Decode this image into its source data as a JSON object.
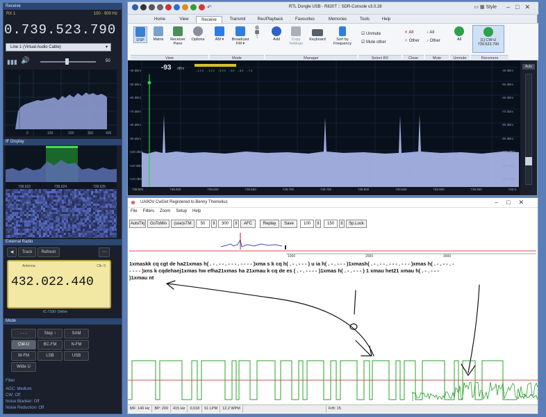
{
  "left": {
    "header": "Receive",
    "rx": "RX 1",
    "rx_range": "100 - 900 Hz",
    "frequency": "0.739.523.790",
    "line_select": "Line 1 (Virtual Audio Cable)",
    "volume": "50",
    "spectrum_ticks": [
      "0",
      "100",
      "200",
      "300",
      "400"
    ],
    "if_header": "IF Display",
    "if_ticks": [
      "739.523",
      "739.524",
      "739.525"
    ],
    "ext_header": "External Radio",
    "track": "Track",
    "refresh": "Refresh",
    "antenna": "Antenna",
    "clk": "Clk: 0",
    "ext_freq": "432.022.440",
    "ext_status": "IC-7100: Online",
    "mode_header": "Mode",
    "modes": [
      "- - -",
      "Step ↑",
      "SAM",
      "CW-U",
      "BC-FM",
      "N-FM",
      "W-FM",
      "LSB",
      "USB",
      "Wide U"
    ],
    "filter_header": "Filter",
    "filters": [
      "AGC: Medium",
      "CW: Off",
      "Noise Blanker: Off",
      "Noise Reduction: Off"
    ]
  },
  "app": {
    "title": "RTL Dongle USB - R820T :: SDR-Console v3.0.28",
    "style_label": "Style",
    "tabs": [
      "Home",
      "View",
      "Receive",
      "Transmit",
      "Rec/Playback",
      "Favourites",
      "Memories",
      "Tools",
      "Help"
    ],
    "ribbon": [
      {
        "label": "DSP",
        "color": "#3a7fd0"
      },
      {
        "label": "Matrix",
        "color": "#7aa0cf"
      },
      {
        "label": "Receiver Pane",
        "color": "#4a8f5a"
      },
      {
        "label": "Options",
        "color": "#8a8f99"
      },
      {
        "label": "AM",
        "color": "#2f7de0"
      },
      {
        "label": "Broadcast FM",
        "color": "#2f7de0"
      },
      {
        "label": "Add",
        "color": "#2d63c8"
      },
      {
        "label": "Copy Settings",
        "color": "#a9b0bb"
      },
      {
        "label": "Keyboard",
        "color": "#55606e"
      },
      {
        "label": "Sort by Frequency",
        "color": "#2f7de0"
      },
      {
        "label": "All",
        "color": "#2ea04a"
      }
    ],
    "unmute": "Unmute",
    "mute_other": "Mute other",
    "close_all": "All",
    "close_other": "Other",
    "mute_all": "All",
    "mute_other2": "Other",
    "receiver_tag": "[1] CW-U",
    "receiver_freq": "739.523.790",
    "groups": [
      "View",
      "Mode",
      "Manager",
      "Select RX",
      "Close",
      "Mute",
      "Unmute",
      "Receivers"
    ],
    "signal": "-93",
    "signal_unit": "dBm",
    "smeter_ticks": [
      "-120",
      "-110",
      "-100",
      "-90",
      "-80",
      "-70"
    ],
    "dbm_left": [
      "-40 dBm",
      "-50 dBm",
      "-60 dBm",
      "-70 dBm",
      "-80 dBm",
      "-90 dBm",
      "-100 dBm",
      "-110 dBm",
      "-120 dBm"
    ],
    "dbm_right": [
      "-40 dBm",
      "-50 dBm",
      "-60 dBm",
      "-70 dBm",
      "-80 dBm",
      "-90 dBm",
      "-100 dBm",
      "-110 dBm",
      "-120 dBm"
    ],
    "side_btn": "Auto",
    "freq_axis": [
      "739.500",
      "739.550",
      "739.600",
      "739.650",
      "739.700",
      "739.750",
      "739.800",
      "739.850",
      "739.900",
      "739.950",
      "740.0"
    ]
  },
  "cw": {
    "title": "UA9OV CwGet   Registered to Benny Thomelius",
    "menu": [
      "File",
      "Filters",
      "Zoom",
      "Setup",
      "Help"
    ],
    "toolbar": [
      {
        "label": "AutoTkj"
      },
      {
        "label": "GoToMin"
      },
      {
        "label": "(use)sTM"
      },
      {
        "label": "50"
      },
      {
        "label": "300"
      },
      {
        "label": "AFC"
      },
      {
        "label": "Replay"
      },
      {
        "label": "Save"
      },
      {
        "label": "100"
      },
      {
        "label": "150"
      },
      {
        "label": "Sp.Lock"
      }
    ],
    "ruler": [
      "1000",
      "2000",
      "3000"
    ],
    "decoded_line1": "1xmaskk cq cgt de ha21xmas h( . - . - - . - - - . - - - - )xma s k cq h( . - . - - - ) u ia h( . - . - - - )1xmash( . - . - - . - - - . - - - )xmas h( . - . - - . -",
    "decoded_line2": "- - - - )xns k cqdehaej1xmas hw efha21xmas ha 21xmau k cq de es ( . - . - - - - )1xmas h( . - . - - - ) 1 xmau het21 xmau h( . - . - - -",
    "decoded_line3": ")1xmau nt",
    "status": [
      "MF: 140 Hz",
      "BP: 200",
      "415 Hz",
      "0,018",
      "61 LPM",
      "12,2 WPM",
      "",
      "FrB: 15"
    ]
  },
  "colors": {
    "accent": "#2c4674",
    "spectrum": "#c8d4ff",
    "trace": "#2aa02a",
    "threshold": "#d02020"
  }
}
